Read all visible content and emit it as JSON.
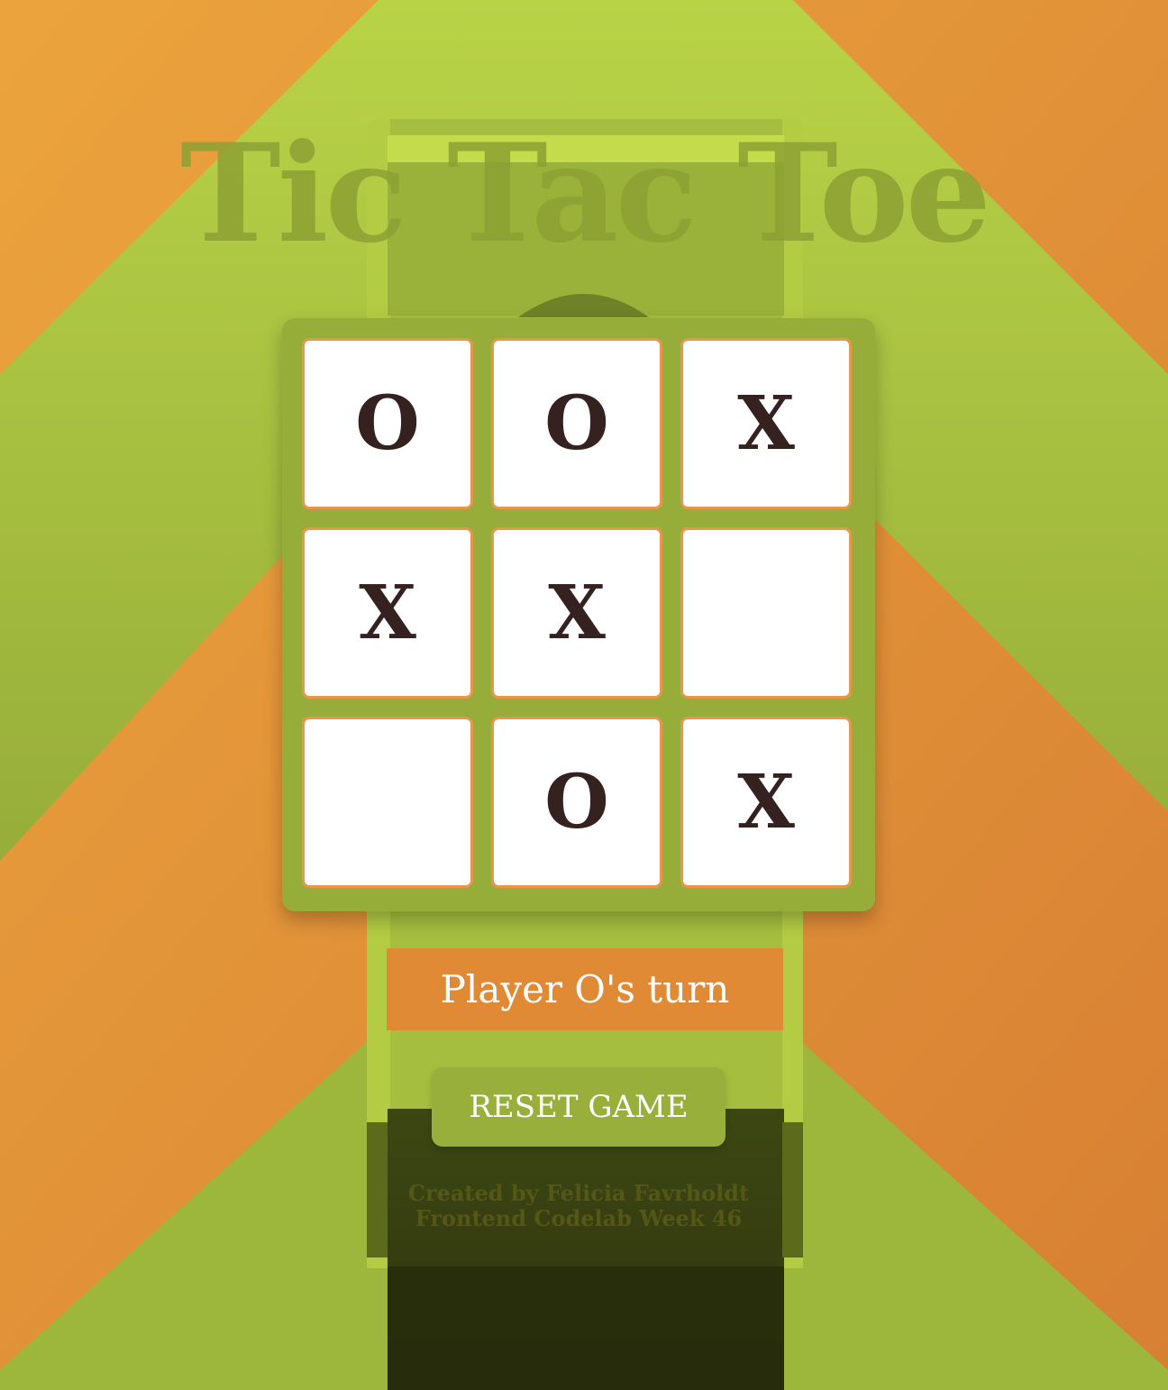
{
  "title": "Tic Tac Toe",
  "board": {
    "cells": [
      "O",
      "O",
      "X",
      "X",
      "X",
      "",
      "",
      "O",
      "X"
    ]
  },
  "status": {
    "turn_text": "Player O's turn"
  },
  "controls": {
    "reset_label": "RESET GAME"
  },
  "footer": {
    "line1": "Created by Felicia Favrholdt",
    "line2": "Frontend Codelab Week 46"
  },
  "colors": {
    "orange": "#e08a36",
    "green": "#9fb83d",
    "mark": "#35211f",
    "cell_border": "#e8964a"
  }
}
